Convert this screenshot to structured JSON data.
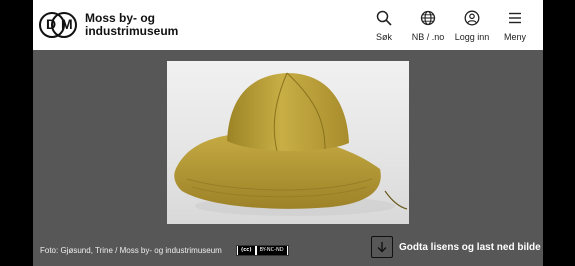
{
  "header": {
    "logo_letters": [
      "D",
      "M"
    ],
    "logo_text_line1": "Moss by- og",
    "logo_text_line2": "industrimuseum"
  },
  "nav": {
    "search_label": "Søk",
    "lang_label": "NB / .no",
    "login_label": "Logg inn",
    "menu_label": "Meny"
  },
  "photo": {
    "subject": "Sydvest hat",
    "license_badge": {
      "cc": "(cc)",
      "terms": "BY-NC-ND"
    }
  },
  "caption": "Foto: Gjøsund, Trine / Moss by- og industrimuseum",
  "download_label": "Godta lisens og last ned bilde",
  "colors": {
    "background": "#575757",
    "header": "#ffffff",
    "hat": "#b9a03a"
  }
}
